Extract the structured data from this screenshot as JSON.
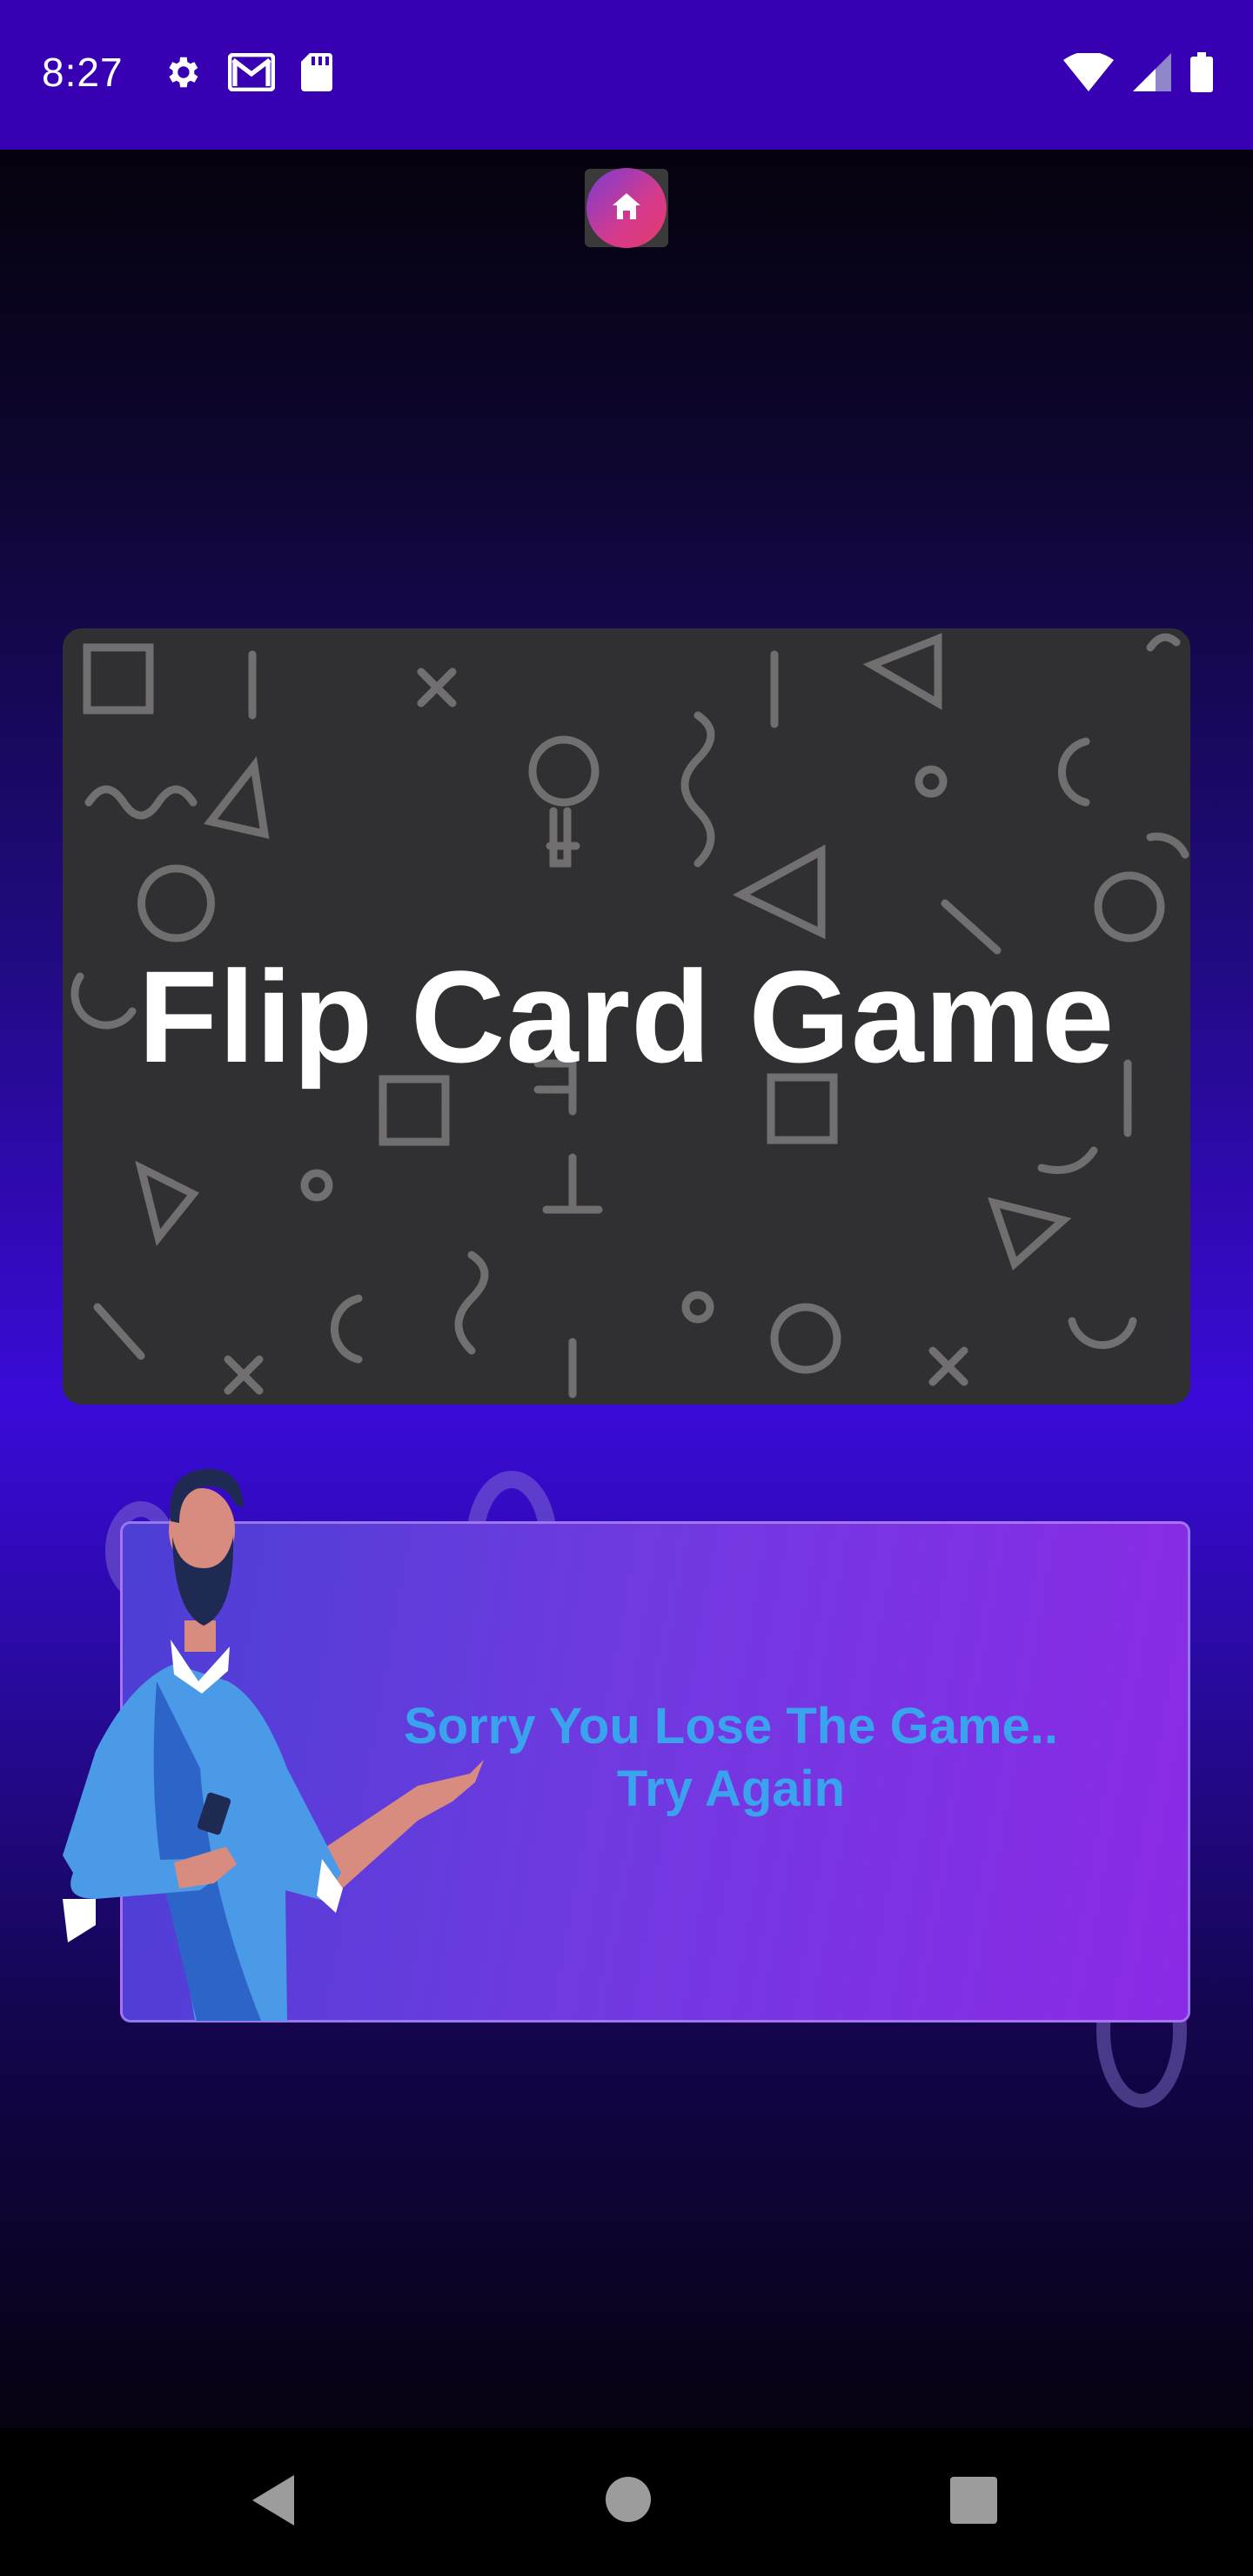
{
  "status_bar": {
    "time": "8:27",
    "left_icons": [
      "gear-icon",
      "gmail-icon",
      "sd-card-icon"
    ],
    "right_icons": [
      "wifi-icon",
      "cell-signal-icon",
      "battery-icon"
    ],
    "background": "#3700b3"
  },
  "app": {
    "home_button_icon": "home-icon",
    "title": "Flip Card Game",
    "result_message_line1": "Sorry You Lose The Game..",
    "result_message_line2": "Try Again",
    "colors": {
      "title_card": "#302f31",
      "result_text": "#3aa3ee",
      "result_card_start": "#4b3fd4",
      "result_card_end": "#8b2ae6"
    }
  },
  "nav_bar": {
    "buttons": [
      "back-icon",
      "home-circle-icon",
      "recents-icon"
    ]
  }
}
